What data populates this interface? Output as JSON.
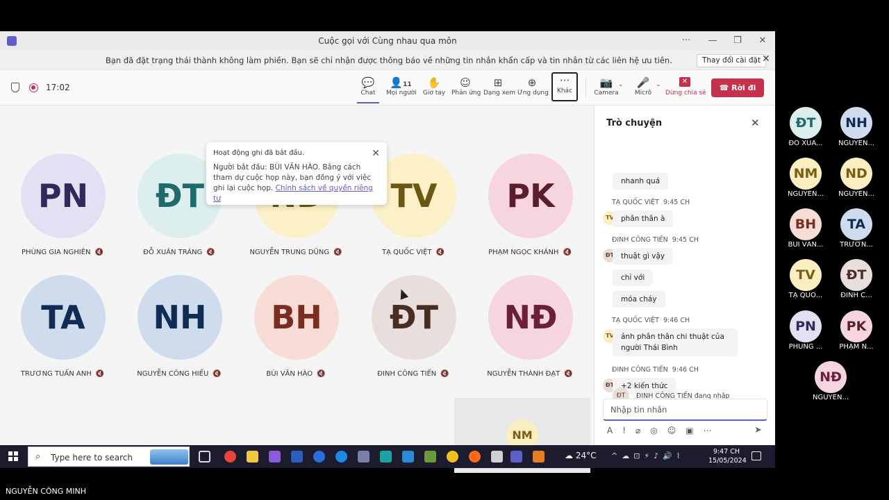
{
  "window": {
    "title": "Cuộc gọi với Cùng nhau qua môn"
  },
  "banner": {
    "text": "Bạn đã đặt trạng thái thành không làm phiền. Bạn sẽ chỉ nhận được thông báo về những tin nhắn khẩn cấp và tin nhắn từ các liên hệ ưu tiên.",
    "button": "Thay đổi cài đặt"
  },
  "toolbar": {
    "timer": "17:02",
    "chat": "Chat",
    "people": "Mọi người",
    "people_count": "11",
    "raise": "Giơ tay",
    "react": "Phản ứng",
    "view": "Dạng xem",
    "apps": "Ứng dụng",
    "more": "Khác",
    "camera": "Camera",
    "mic": "Micrô",
    "share": "Dừng chia sẻ",
    "leave": "Rời đi"
  },
  "popup": {
    "heading": "Hoạt động ghi đã bắt đầu.",
    "body": "Người bắt đầu: BÙI VĂN HÀO. Bằng cách tham dự cuộc họp này, bạn đồng ý với việc ghi lại cuộc họp.",
    "link": "Chính sách về quyền riêng tư"
  },
  "participants": [
    {
      "initials": "PN",
      "name": "PHÙNG GIA NGHIÊN",
      "bg": "#e3e0f3",
      "fg": "#2f2a5a"
    },
    {
      "initials": "ĐT",
      "name": "ĐỖ XUÂN TRÁNG",
      "bg": "#dcefee",
      "fg": "#1f6b6b"
    },
    {
      "initials": "ND",
      "name": "NGUYỄN TRUNG DŨNG",
      "bg": "#fbf0c8",
      "fg": "#6b5614"
    },
    {
      "initials": "TV",
      "name": "TẠ QUỐC VIỆT",
      "bg": "#fbf0c8",
      "fg": "#6b5614"
    },
    {
      "initials": "PK",
      "name": "PHẠM NGỌC KHÁNH",
      "bg": "#f7d5df",
      "fg": "#5a1f2e"
    },
    {
      "initials": "TA",
      "name": "TRƯƠNG TUẤN ANH",
      "bg": "#cfdcee",
      "fg": "#0f2c55"
    },
    {
      "initials": "NH",
      "name": "NGUYỄN CÔNG HIẾU",
      "bg": "#cfdcee",
      "fg": "#0f2c55"
    },
    {
      "initials": "BH",
      "name": "BÙI VĂN HÀO",
      "bg": "#f8dcd6",
      "fg": "#7a2e22"
    },
    {
      "initials": "ĐT",
      "name": "ĐINH CÔNG TIẾN",
      "bg": "#e8dfdc",
      "fg": "#4a2e24"
    },
    {
      "initials": "NĐ",
      "name": "NGUYỄN THÀNH ĐẠT",
      "bg": "#f7d5df",
      "fg": "#6b1f38"
    }
  ],
  "self_view": {
    "initials": "NM"
  },
  "chat": {
    "title": "Trò chuyện",
    "messages": [
      {
        "text": "nhanh quá"
      },
      {
        "sender": "TẠ QUỐC VIỆT",
        "time": "9:45 CH",
        "av": "TV",
        "text": "phân thân à"
      },
      {
        "sender": "ĐINH CÔNG TIẾN",
        "time": "9:45 CH",
        "av": "ĐT",
        "text": "thuật gì vậy"
      },
      {
        "text": "chỉ với"
      },
      {
        "text": "móa cháy"
      },
      {
        "sender": "TẠ QUỐC VIỆT",
        "time": "9:46 CH",
        "av": "TV",
        "text": "ảnh phân thân chi thuật của người Thái Bình"
      },
      {
        "sender": "ĐINH CÔNG TIẾN",
        "time": "9:46 CH",
        "av": "ĐT",
        "text": "+2 kiến thức"
      }
    ],
    "typing_av": "ĐT",
    "typing": "ĐINH CÔNG TIẾN đang nhập",
    "placeholder": "Nhập tin nhắn"
  },
  "taskbar": {
    "search": "Type here to search",
    "weather": "24°C",
    "time": "9:47 CH",
    "date": "15/05/2024"
  },
  "gallery": [
    {
      "initials": "ĐT",
      "name": "ĐỖ XUÂ...",
      "bg": "#dcefee",
      "fg": "#1f6b6b"
    },
    {
      "initials": "NH",
      "name": "NGUYỄN...",
      "bg": "#cfdcee",
      "fg": "#0f2c55"
    },
    {
      "initials": "NM",
      "name": "NGUYỄN...",
      "bg": "#fbeec0",
      "fg": "#7a5c14"
    },
    {
      "initials": "ND",
      "name": "NGUYỄN...",
      "bg": "#fbeec0",
      "fg": "#7a5c14"
    },
    {
      "initials": "BH",
      "name": "BÙI VĂN...",
      "bg": "#f8dcd6",
      "fg": "#7a2e22"
    },
    {
      "initials": "TA",
      "name": "TRƯƠN...",
      "bg": "#cfdcee",
      "fg": "#0f2c55"
    },
    {
      "initials": "TV",
      "name": "TẠ QUỐ...",
      "bg": "#fbeec0",
      "fg": "#7a5c14"
    },
    {
      "initials": "ĐT",
      "name": "ĐINH C...",
      "bg": "#e8dfdc",
      "fg": "#4a2e24"
    },
    {
      "initials": "PN",
      "name": "PHÙNG ...",
      "bg": "#e3e0f3",
      "fg": "#2f2a5a"
    },
    {
      "initials": "PK",
      "name": "PHẠM N...",
      "bg": "#f7d5df",
      "fg": "#5a1f2e"
    },
    {
      "initials": "NĐ",
      "name": "NGUYỄN...",
      "bg": "#f7d5df",
      "fg": "#6b1f38"
    }
  ],
  "footer": {
    "name": "NGUYỄN CÔNG MINH"
  }
}
